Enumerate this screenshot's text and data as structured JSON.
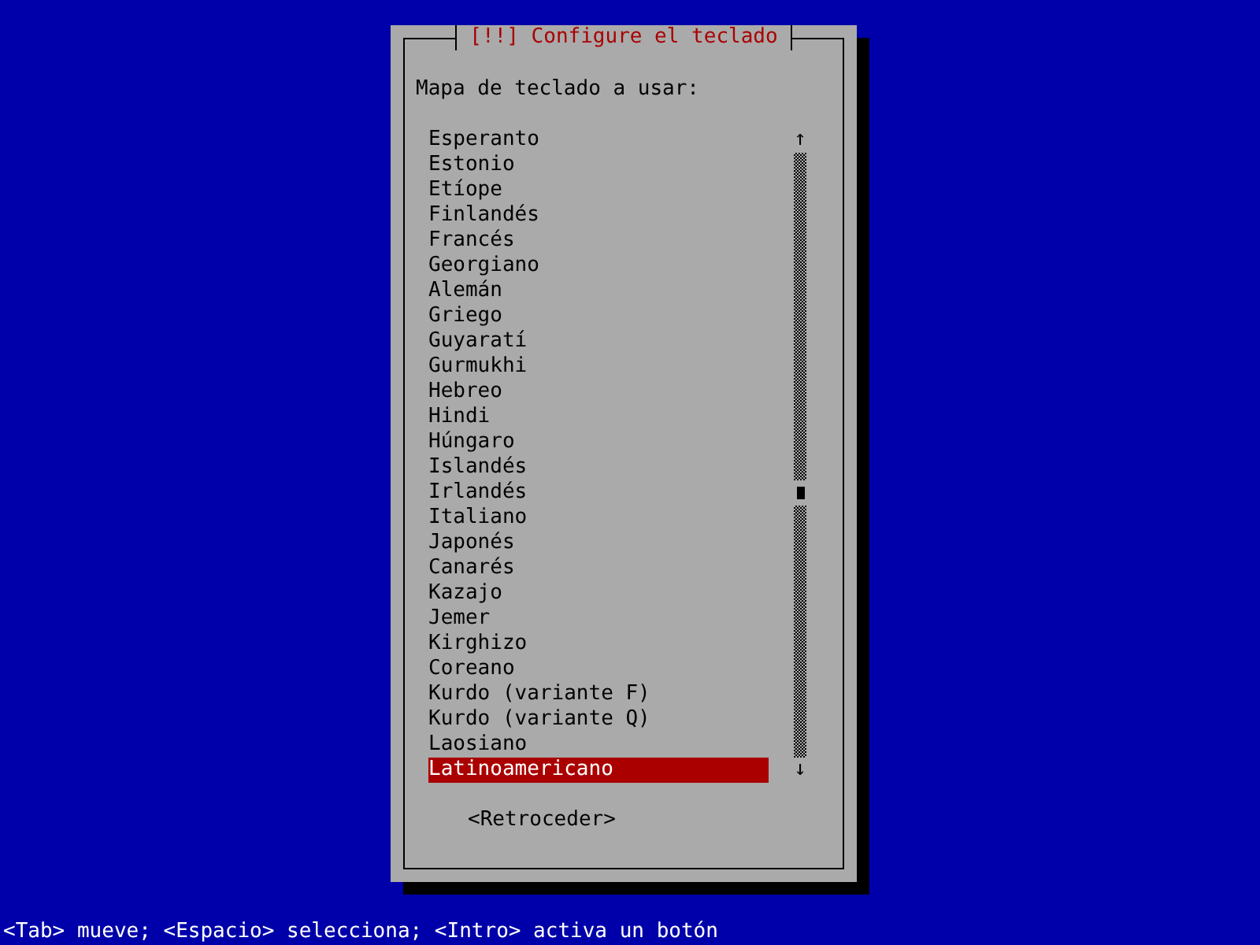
{
  "dialog": {
    "title": "[!!] Configure el teclado",
    "prompt": "Mapa de teclado a usar:",
    "items": [
      {
        "label": "Esperanto",
        "selected": false
      },
      {
        "label": "Estonio",
        "selected": false
      },
      {
        "label": "Etíope",
        "selected": false
      },
      {
        "label": "Finlandés",
        "selected": false
      },
      {
        "label": "Francés",
        "selected": false
      },
      {
        "label": "Georgiano",
        "selected": false
      },
      {
        "label": "Alemán",
        "selected": false
      },
      {
        "label": "Griego",
        "selected": false
      },
      {
        "label": "Guyaratí",
        "selected": false
      },
      {
        "label": "Gurmukhi",
        "selected": false
      },
      {
        "label": "Hebreo",
        "selected": false
      },
      {
        "label": "Hindi",
        "selected": false
      },
      {
        "label": "Húngaro",
        "selected": false
      },
      {
        "label": "Islandés",
        "selected": false
      },
      {
        "label": "Irlandés",
        "selected": false
      },
      {
        "label": "Italiano",
        "selected": false
      },
      {
        "label": "Japonés",
        "selected": false
      },
      {
        "label": "Canarés",
        "selected": false
      },
      {
        "label": "Kazajo",
        "selected": false
      },
      {
        "label": "Jemer",
        "selected": false
      },
      {
        "label": "Kirghizo",
        "selected": false
      },
      {
        "label": "Coreano",
        "selected": false
      },
      {
        "label": "Kurdo (variante F)",
        "selected": false
      },
      {
        "label": "Kurdo (variante Q)",
        "selected": false
      },
      {
        "label": "Laosiano",
        "selected": false
      },
      {
        "label": "Latinoamericano",
        "selected": true
      }
    ],
    "scroll_up": "↑",
    "scroll_down": "↓",
    "button": "<Retroceder>"
  },
  "status_bar": "<Tab> mueve; <Espacio> selecciona; <Intro> activa un botón"
}
